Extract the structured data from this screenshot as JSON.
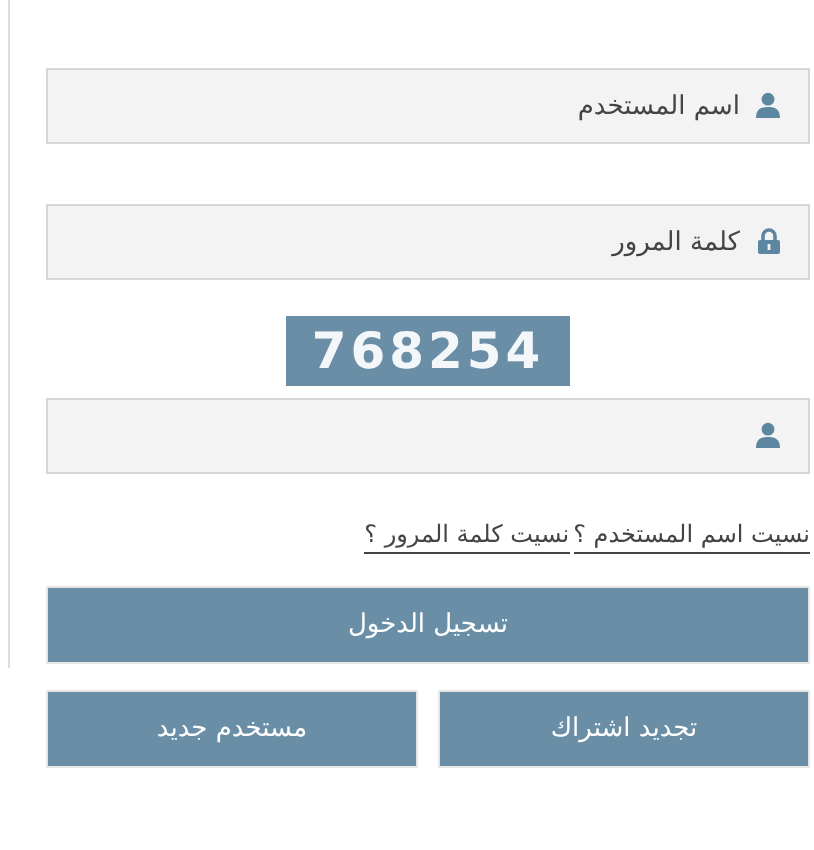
{
  "fields": [
    {
      "kind": "user",
      "placeholder": "اسم المستخدم"
    },
    {
      "kind": "lock",
      "placeholder": "كلمة المرور"
    }
  ],
  "captcha": {
    "text": "768254"
  },
  "captcha_field": {
    "kind": "user"
  },
  "links": [
    "نسيت اسم المستخدم ؟",
    "نسيت كلمة المرور ؟"
  ],
  "login_button": "تسجيل الدخول",
  "buttons": [
    "تجديد اشتراك",
    "مستخدم جديد"
  ]
}
